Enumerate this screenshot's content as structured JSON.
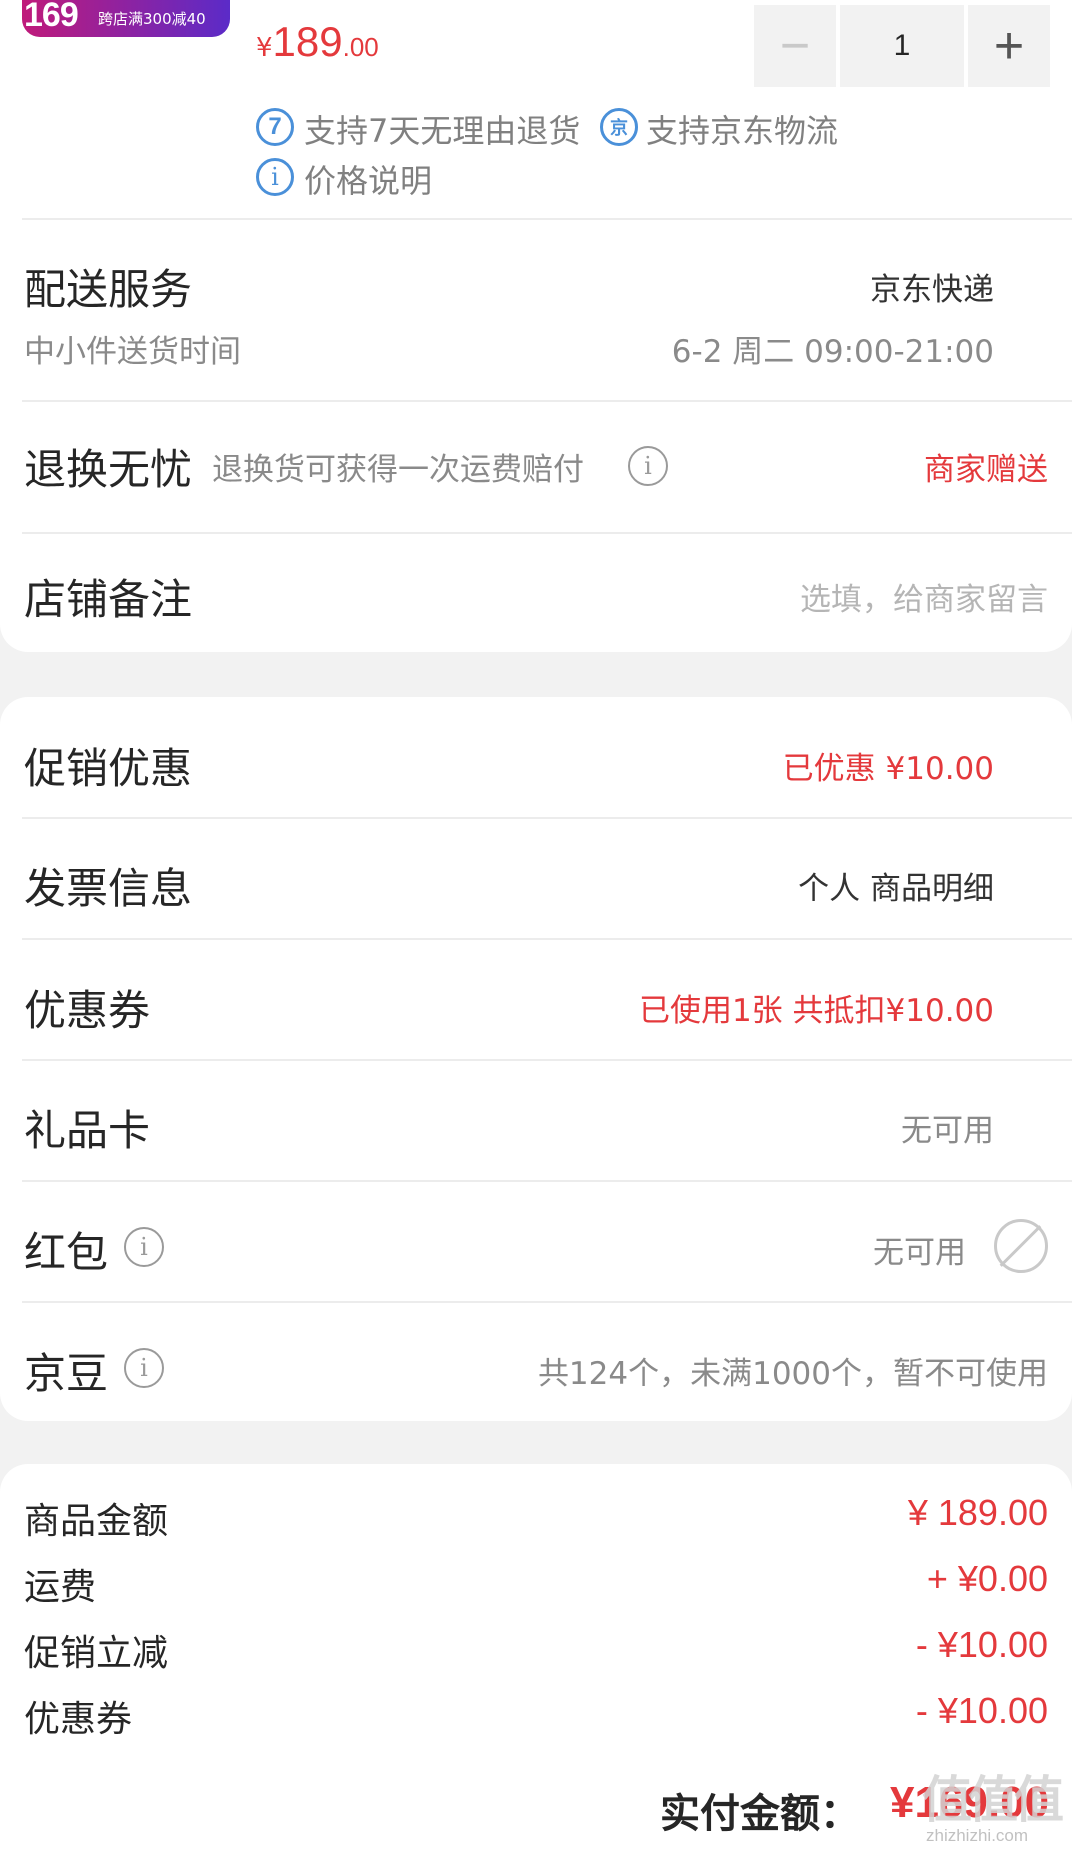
{
  "product": {
    "thumb_badge_number": "169",
    "thumb_badge_text": "跨店满300减40",
    "price_currency": "¥",
    "price_integer": "189",
    "price_decimal": ".00",
    "quantity": "1",
    "minus_symbol": "−",
    "plus_symbol": "+",
    "tags": [
      {
        "icon": "7",
        "icon_name": "seven-day-return-icon",
        "text": "支持7天无理由退货"
      },
      {
        "icon": "京",
        "icon_name": "jd-logistics-icon",
        "text": "支持京东物流"
      },
      {
        "icon": "i",
        "icon_name": "info-icon",
        "text": "价格说明"
      }
    ]
  },
  "delivery": {
    "title": "配送服务",
    "value": "京东快递",
    "sub_label": "中小件送货时间",
    "sub_value": "6-2 周二 09:00-21:00"
  },
  "return_worry": {
    "title": "退换无忧",
    "desc": "退换货可获得一次运费赔付",
    "value": "商家赠送"
  },
  "store_note": {
    "title": "店铺备注",
    "placeholder": "选填，给商家留言"
  },
  "options": [
    {
      "label": "促销优惠",
      "value": "已优惠 ¥10.00"
    },
    {
      "label": "发票信息",
      "value": "个人 商品明细"
    },
    {
      "label": "优惠券",
      "value": "已使用1张 共抵扣¥10.00"
    },
    {
      "label": "礼品卡",
      "value": "无可用"
    },
    {
      "label": "红包",
      "value": "无可用"
    },
    {
      "label": "京豆",
      "value": "共124个，未满1000个，暂不可使用"
    }
  ],
  "summary": [
    {
      "label": "商品金额",
      "value": "¥ 189.00"
    },
    {
      "label": "运费",
      "value": "+ ¥0.00"
    },
    {
      "label": "促销立减",
      "value": "- ¥10.00"
    },
    {
      "label": "优惠券",
      "value": "- ¥10.00"
    }
  ],
  "total": {
    "label": "实付金额：",
    "value": "¥169.00"
  },
  "watermark": {
    "big": "值值值",
    "small": "zhizhizhi.com"
  },
  "colors": {
    "accent_red": "#e4393c",
    "tag_blue": "#4a90d9",
    "page_bg": "#f2f2f2"
  }
}
